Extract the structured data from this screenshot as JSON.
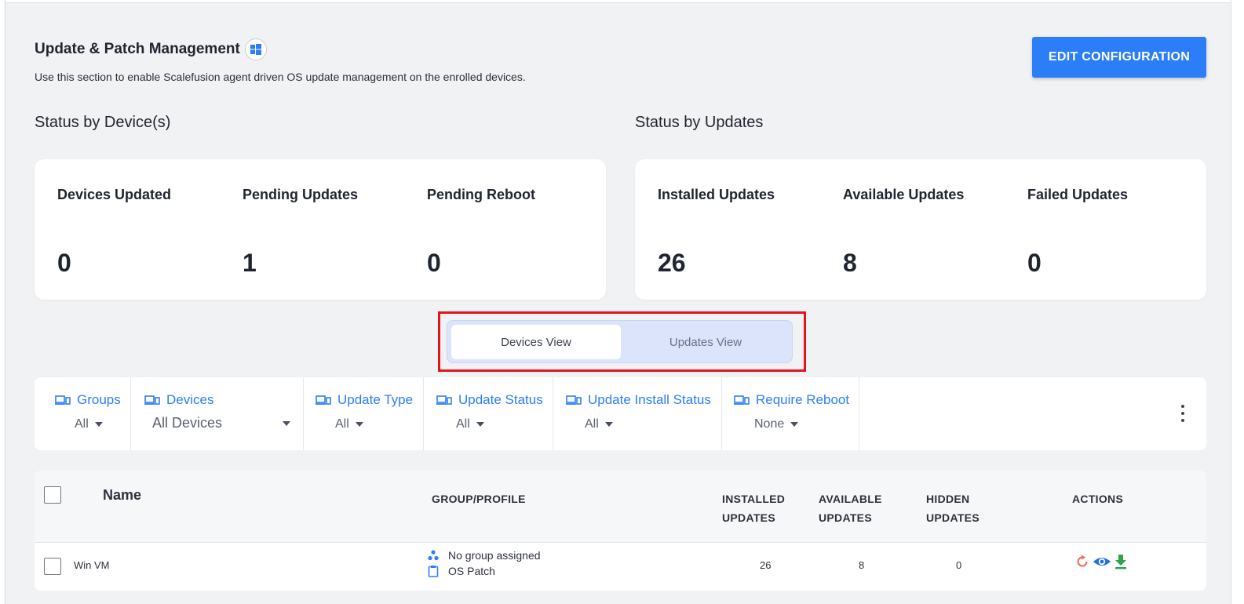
{
  "page": {
    "title": "Update & Patch Management",
    "subtitle": "Use this section to enable Scalefusion agent driven OS update management on the enrolled devices.",
    "edit_button": "EDIT CONFIGURATION",
    "platform_icon": "windows-icon"
  },
  "status_by_devices": {
    "heading": "Status by Device(s)",
    "stats": [
      {
        "label": "Devices Updated",
        "value": "0"
      },
      {
        "label": "Pending Updates",
        "value": "1"
      },
      {
        "label": "Pending Reboot",
        "value": "0"
      }
    ]
  },
  "status_by_updates": {
    "heading": "Status by Updates",
    "stats": [
      {
        "label": "Installed Updates",
        "value": "26"
      },
      {
        "label": "Available Updates",
        "value": "8"
      },
      {
        "label": "Failed Updates",
        "value": "0"
      }
    ]
  },
  "view_toggle": {
    "tabs": [
      {
        "label": "Devices View",
        "active": true
      },
      {
        "label": "Updates View",
        "active": false
      }
    ]
  },
  "filters": [
    {
      "label": "Groups",
      "value": "All"
    },
    {
      "label": "Devices",
      "value": "All Devices"
    },
    {
      "label": "Update Type",
      "value": "All"
    },
    {
      "label": "Update Status",
      "value": "All"
    },
    {
      "label": "Update Install Status",
      "value": "All"
    },
    {
      "label": "Require Reboot",
      "value": "None"
    }
  ],
  "table": {
    "headers": {
      "name": "Name",
      "group_profile": "GROUP/PROFILE",
      "installed_1": "INSTALLED",
      "installed_2": "UPDATES",
      "available_1": "AVAILABLE",
      "available_2": "UPDATES",
      "hidden_1": "HIDDEN",
      "hidden_2": "UPDATES",
      "actions": "ACTIONS"
    },
    "rows": [
      {
        "name": "Win VM",
        "group": "No group assigned",
        "profile": "OS Patch",
        "installed": "26",
        "available": "8",
        "hidden": "0",
        "actions": [
          "refresh-icon",
          "eye-icon",
          "download-icon"
        ]
      }
    ]
  },
  "colors": {
    "accent": "#2c7ef8",
    "highlight": "#e5141b",
    "refresh": "#f06a63",
    "view": "#1f6fe8",
    "download": "#2aa34a"
  }
}
